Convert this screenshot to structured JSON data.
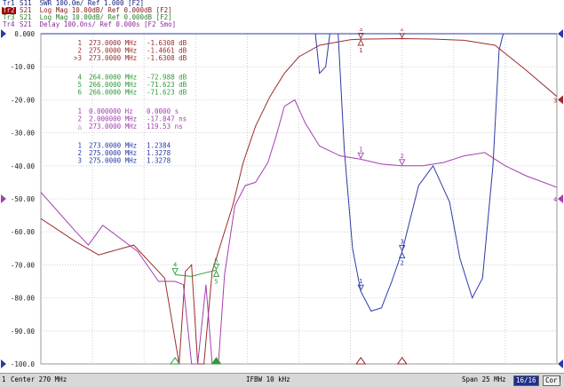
{
  "trace_header": [
    {
      "id": "Tr1",
      "text": " S11  SWR 100.0m/ Ref 1.000 [F2]",
      "color": "#1a237e",
      "active": false
    },
    {
      "id": "Tr2",
      "text": " S21  Log Mag 10.00dB/ Ref 0.000dB [F2]",
      "color": "#8b1a1a",
      "active": true
    },
    {
      "id": "Tr3",
      "text": " S21  Log Mag 10.00dB/ Ref 0.000dB [F2]",
      "color": "#2e7d32",
      "active": false
    },
    {
      "id": "Tr4",
      "text": " S21  Delay 100.0ns/ Ref 0.000s [F2 Smo]",
      "color": "#8e2a9e",
      "active": false
    }
  ],
  "chart_data": {
    "type": "line",
    "title": "",
    "xlabel": "",
    "ylabel": "",
    "x_unit": "MHz",
    "xlim": [
      257.5,
      282.5
    ],
    "ylim": [
      -100,
      0
    ],
    "y_ticks": [
      "0.000",
      "-10.00",
      "-20.00",
      "-30.00",
      "-40.00",
      "-50.00",
      "-60.00",
      "-70.00",
      "-80.00",
      "-90.00",
      "-100.0"
    ],
    "y_tick_values": [
      0,
      -10,
      -20,
      -30,
      -40,
      -50,
      -60,
      -70,
      -80,
      -90,
      -100
    ],
    "grid": true,
    "series": [
      {
        "trace": "Tr1",
        "color": "#2b3aa8",
        "x": [
          257.5,
          270.8,
          271.0,
          271.3,
          271.5,
          271.9,
          272.2,
          272.6,
          273.0,
          273.5,
          274.0,
          274.5,
          275.0,
          275.8,
          276.5,
          277.3,
          277.8,
          278.4,
          278.9,
          279.4,
          279.7,
          279.9,
          282.5
        ],
        "y": [
          0,
          0,
          -12,
          -10,
          0,
          0,
          -35,
          -65,
          -78,
          -84,
          -83,
          -75,
          -66,
          -46,
          -40,
          -51,
          -68,
          -80,
          -74,
          -40,
          -5,
          0,
          0
        ]
      },
      {
        "trace": "Tr2",
        "color": "#9b2d2d",
        "x": [
          257.5,
          259.2,
          260.3,
          262.0,
          263.5,
          264.2,
          264.5,
          264.8,
          265.1,
          265.4,
          265.8,
          266.0,
          266.4,
          266.8,
          267.3,
          267.9,
          268.6,
          269.3,
          270.0,
          271.0,
          272.5,
          273.0,
          275.0,
          276.5,
          278.0,
          279.5,
          281.0,
          282.5
        ],
        "y": [
          -56,
          -63,
          -67,
          -64,
          -74,
          -100,
          -72,
          -70,
          -100,
          -100,
          -72,
          -68,
          -60,
          -52,
          -39,
          -28,
          -19,
          -12,
          -7,
          -3.5,
          -1.8,
          -1.63,
          -1.47,
          -1.6,
          -2.0,
          -3.5,
          -11,
          -19
        ]
      },
      {
        "trace": "Tr3",
        "color": "#2e9b3a",
        "x": [
          264.0,
          264.8,
          265.4,
          266.0
        ],
        "y": [
          -72.99,
          -73.5,
          -72.5,
          -71.62
        ]
      },
      {
        "trace": "Tr4",
        "color": "#a43fb0",
        "x": [
          257.5,
          259.2,
          259.8,
          260.5,
          262.2,
          263.2,
          264.0,
          264.4,
          264.8,
          265.1,
          265.5,
          265.8,
          266.1,
          266.4,
          266.9,
          267.4,
          267.9,
          268.5,
          268.9,
          269.3,
          269.8,
          270.3,
          271.0,
          272.0,
          273.0,
          274.0,
          275.0,
          276.0,
          277.0,
          278.0,
          279.0,
          280.0,
          281.0,
          282.5
        ],
        "y": [
          -48,
          -60,
          -64,
          -58,
          -66,
          -75,
          -75,
          -76,
          -100,
          -100,
          -76,
          -100,
          -100,
          -73,
          -52,
          -46,
          -45,
          -39,
          -31,
          -22,
          -20,
          -27,
          -34,
          -37,
          -38,
          -39.5,
          -40,
          -40,
          -39,
          -37,
          -36,
          -40,
          -43,
          -46.5
        ]
      }
    ],
    "markers": [
      {
        "trace": "Tr2",
        "labels": [
          "3",
          "1"
        ],
        "x": 273.0,
        "y": -1.63,
        "color": "#9b2d2d"
      },
      {
        "trace": "Tr2",
        "labels": [
          "2"
        ],
        "x": 275.0,
        "y": -1.47,
        "color": "#9b2d2d"
      },
      {
        "trace": "Tr1",
        "labels": [
          "1"
        ],
        "x": 273.0,
        "y": -78,
        "color": "#2b3aa8"
      },
      {
        "trace": "Tr1",
        "labels": [
          "3",
          "2"
        ],
        "x": 275.0,
        "y": -66,
        "color": "#2b3aa8"
      },
      {
        "trace": "Tr3",
        "labels": [
          "4"
        ],
        "x": 264.0,
        "y": -72.99,
        "color": "#2e9b3a"
      },
      {
        "trace": "Tr3",
        "labels": [
          "6",
          "5"
        ],
        "x": 266.0,
        "y": -71.62,
        "color": "#2e9b3a"
      },
      {
        "trace": "Tr4",
        "labels": [
          "1"
        ],
        "x": 273.0,
        "y": -38,
        "color": "#a43fb0"
      },
      {
        "trace": "Tr4",
        "labels": [
          "2"
        ],
        "x": 275.0,
        "y": -40,
        "color": "#a43fb0"
      }
    ],
    "bottom_markers": [
      {
        "x": 264.0,
        "color": "#2e9b3a",
        "filled": false
      },
      {
        "x": 266.0,
        "color": "#2e9b3a",
        "filled": true
      },
      {
        "x": 273.0,
        "color": "#9b2d2d",
        "filled": true
      },
      {
        "x": 275.0,
        "color": "#2b3aa8",
        "filled": true
      },
      {
        "x": 273.0,
        "color": "#9b2d2d",
        "filled": false
      },
      {
        "x": 275.0,
        "color": "#9b2d2d",
        "filled": false
      }
    ],
    "ref_arrows": [
      {
        "side": "left",
        "y": 0,
        "color": "#2b3aa8",
        "label": ""
      },
      {
        "side": "left",
        "y": -50,
        "color": "#a43fb0",
        "label": ""
      },
      {
        "side": "left",
        "y": -100,
        "color": "#2b3aa8",
        "label": ""
      },
      {
        "side": "right",
        "y": 0,
        "color": "#2b3aa8",
        "label": ""
      },
      {
        "side": "right",
        "y": -20,
        "color": "#9b2d2d",
        "label": "3"
      },
      {
        "side": "right",
        "y": -50,
        "color": "#a43fb0",
        "label": "4"
      },
      {
        "side": "right",
        "y": -100,
        "color": "#2b3aa8",
        "label": ""
      }
    ],
    "marker_tables": [
      {
        "color": "#9b2d2d",
        "rows": [
          {
            "id": "1",
            "freq": "273.0000 MHz",
            "value": "-1.6308 dB"
          },
          {
            "id": "2",
            "freq": "275.0000 MHz",
            "value": "-1.4661 dB"
          },
          {
            "id": ">3",
            "freq": "273.0000 MHz",
            "value": "-1.6308 dB"
          }
        ]
      },
      {
        "color": "#2e9b3a",
        "rows": [
          {
            "id": "4",
            "freq": "264.0000 MHz",
            "value": "-72.988 dB"
          },
          {
            "id": "5",
            "freq": "266.0000 MHz",
            "value": "-71.623 dB"
          },
          {
            "id": "6",
            "freq": "266.0000 MHz",
            "value": "-71.623 dB"
          }
        ]
      },
      {
        "color": "#a43fb0",
        "rows": [
          {
            "id": "1",
            "freq": "0.000000 Hz",
            "value": "0.0000 s"
          },
          {
            "id": "2",
            "freq": "2.000000 MHz",
            "value": "-17.847 ns"
          },
          {
            "id": "△",
            "freq": "273.0000 MHz",
            "value": "119.53 ns"
          }
        ]
      },
      {
        "color": "#2b3aa8",
        "rows": [
          {
            "id": "1",
            "freq": "273.0000 MHz",
            "value": "1.2384"
          },
          {
            "id": "2",
            "freq": "275.0000 MHz",
            "value": "1.3278"
          },
          {
            "id": "3",
            "freq": "275.0000 MHz",
            "value": "1.3278"
          }
        ]
      }
    ]
  },
  "status_bar": {
    "channel": "1",
    "center": "Center 270 MHz",
    "ifbw": "IFBW 10 kHz",
    "span": "Span 25 MHz",
    "points": "16/16",
    "mode": "Cor",
    "flag": "!"
  }
}
